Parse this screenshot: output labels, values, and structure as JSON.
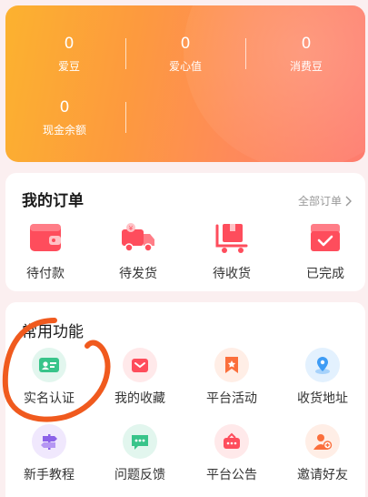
{
  "stats": [
    {
      "value": "0",
      "label": "爱豆"
    },
    {
      "value": "0",
      "label": "爱心值"
    },
    {
      "value": "0",
      "label": "消费豆"
    },
    {
      "value": "0",
      "label": "现金余额"
    }
  ],
  "orders": {
    "title": "我的订单",
    "all_link": "全部订单",
    "items": [
      {
        "label": "待付款",
        "icon": "wallet-icon"
      },
      {
        "label": "待发货",
        "icon": "delivery-truck-icon"
      },
      {
        "label": "待收货",
        "icon": "package-cart-icon"
      },
      {
        "label": "已完成",
        "icon": "completed-box-icon"
      }
    ]
  },
  "functions": {
    "title": "常用功能",
    "items": [
      {
        "label": "实名认证",
        "icon": "id-card-icon"
      },
      {
        "label": "我的收藏",
        "icon": "favorites-icon"
      },
      {
        "label": "平台活动",
        "icon": "activity-flag-icon"
      },
      {
        "label": "收货地址",
        "icon": "location-pin-icon"
      },
      {
        "label": "新手教程",
        "icon": "signpost-icon"
      },
      {
        "label": "问题反馈",
        "icon": "feedback-icon"
      },
      {
        "label": "平台公告",
        "icon": "announcement-icon"
      },
      {
        "label": "邀请好友",
        "icon": "invite-friend-icon"
      }
    ]
  },
  "colors": {
    "accent": "#fe4d5c",
    "card_gradient_start": "#fcb22f",
    "card_gradient_end": "#fe7c6f",
    "annotation": "#f05a1e"
  }
}
